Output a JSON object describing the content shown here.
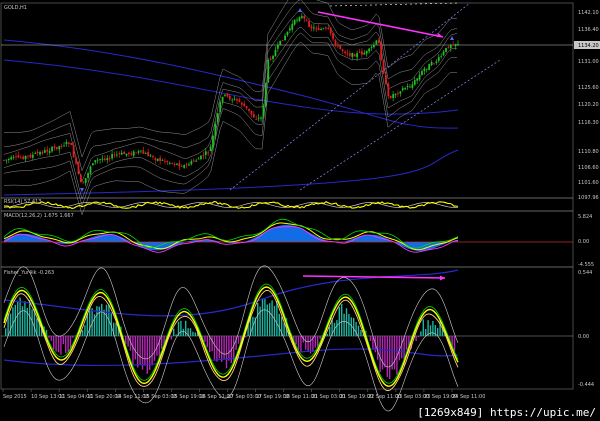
{
  "chart": {
    "symbol_label": "GOLD,H1",
    "current_price_tag": "1134.20",
    "price_axis_ticks": [
      "1142.10",
      "1136.40",
      "1131.00",
      "1125.60",
      "1120.20",
      "1116.30",
      "1110.80",
      "1106.60",
      "1101.60",
      "1097.96"
    ]
  },
  "rsi": {
    "label": "RSI(14) 57.413"
  },
  "macd": {
    "label": "MACD(12,26,2) 1.675 1.667",
    "axis_ticks": [
      "5.824",
      "0.00",
      "-4.555"
    ]
  },
  "fisher": {
    "label": "Fisher_Yur4ik -0.263",
    "axis_ticks": [
      "0.544",
      "0.00",
      "-0.444"
    ]
  },
  "time_axis": {
    "labels": [
      "Sep 2015",
      "10 Sep 13:00",
      "11 Sep 04:00",
      "11 Sep 20:00",
      "14 Sep 11:00",
      "15 Sep 03:00",
      "15 Sep 19:00",
      "16 Sep 11:00",
      "17 Sep 03:00",
      "17 Sep 19:00",
      "18 Sep 11:00",
      "21 Sep 03:00",
      "21 Sep 19:00",
      "22 Sep 11:00",
      "23 Sep 03:00",
      "23 Sep 19:00",
      "24 Sep 11:00"
    ]
  },
  "watermark": "[1269x849] https://upic.me/",
  "colors": {
    "bull": "#22c022",
    "bear": "#e02020",
    "divergence": "#ff33ff",
    "band": "#c0c0c0",
    "slow_ma": "#2828c8",
    "macd_fill": "#1478ff",
    "hist_pos": "#1eb4a0",
    "hist_neg": "#b428b4",
    "yellow": "#ffff00",
    "green_line": "#00e000"
  }
}
